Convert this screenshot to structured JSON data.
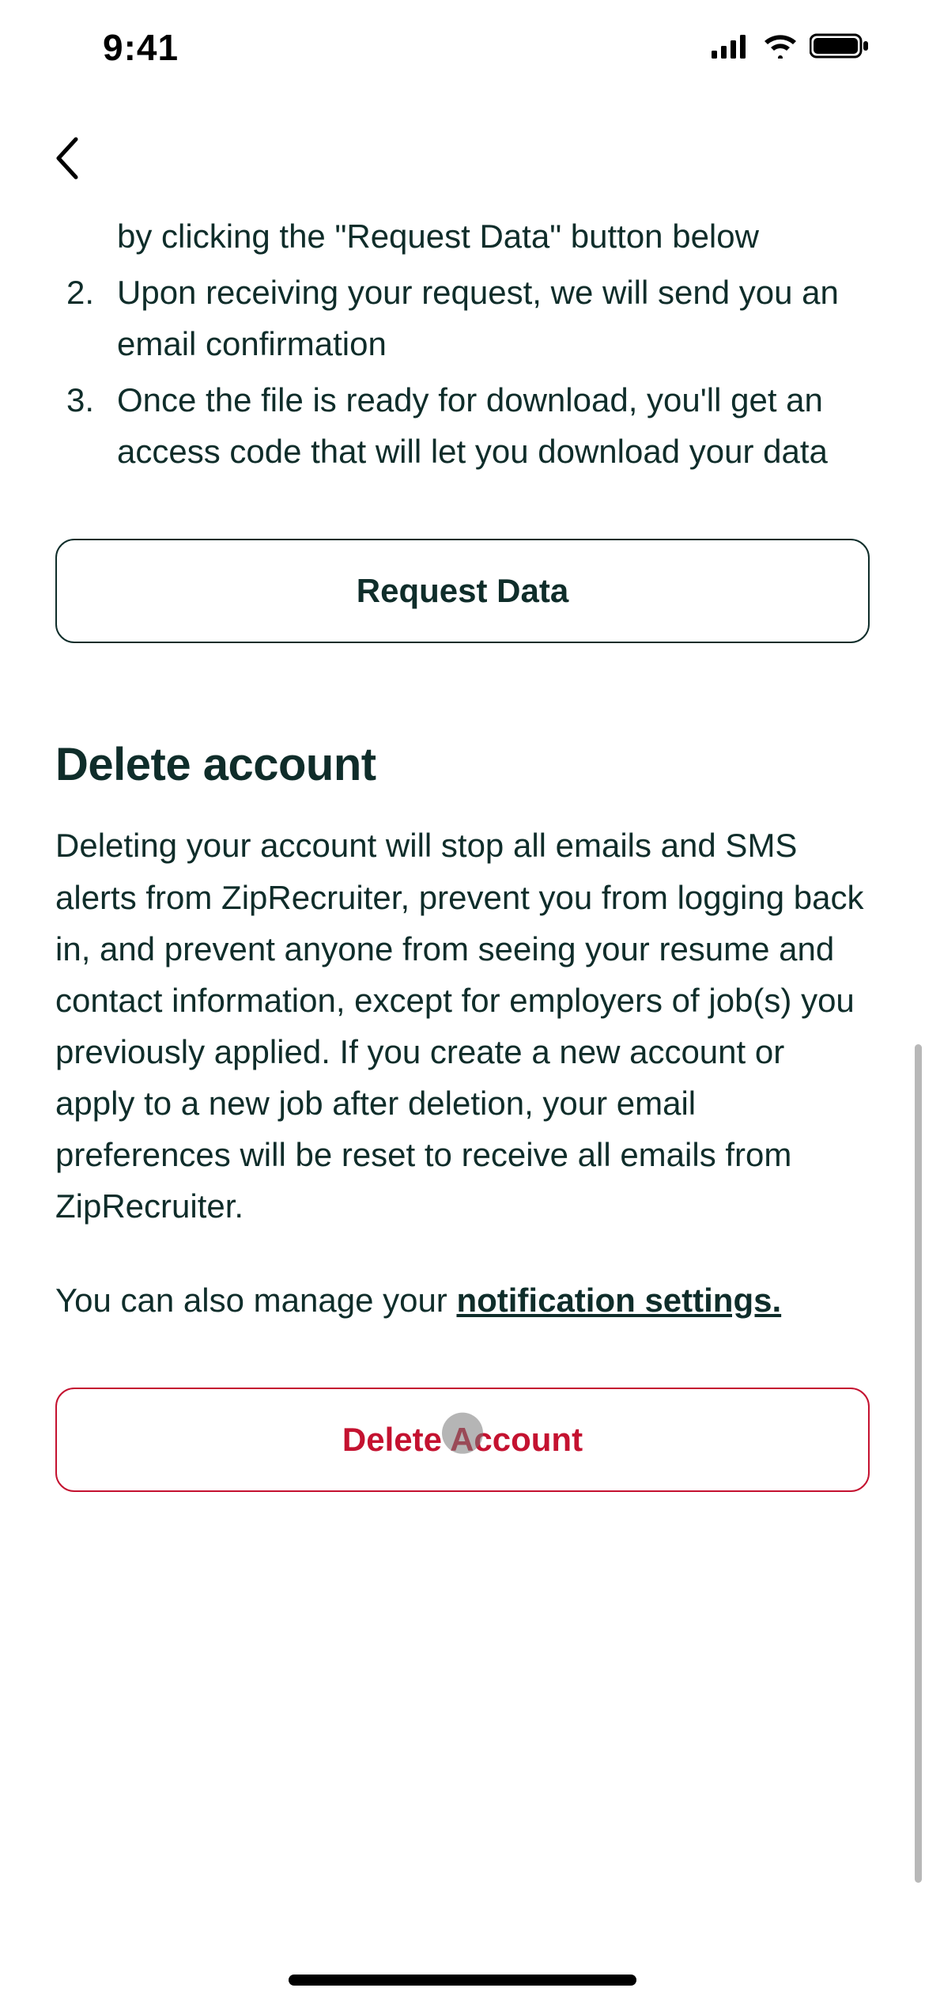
{
  "status": {
    "time": "9:41"
  },
  "request_section": {
    "partial_first": "by clicking the \"Request Data\" button below",
    "step2": "Upon receiving your request, we will send you an email confirmation",
    "step3": "Once the file is ready for download, you'll get an access code that will let you download your data",
    "button": "Request Data"
  },
  "delete_section": {
    "title": "Delete account",
    "body": "Deleting your account will stop all emails and SMS alerts from ZipRecruiter, prevent you from logging back in, and prevent anyone from seeing your resume and contact information, except for employers of job(s) you previously applied. If you create a new account or apply to a new job after deletion, your email preferences will be reset to receive all emails from ZipRecruiter.",
    "manage_prefix": "You can also manage your ",
    "manage_link": "notification settings.",
    "button": "Delete Account"
  }
}
